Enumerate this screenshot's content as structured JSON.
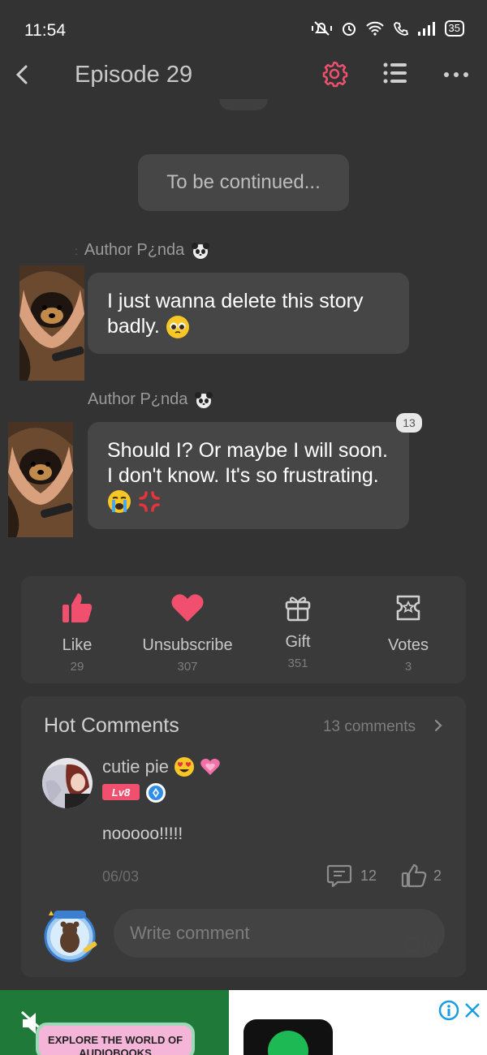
{
  "status": {
    "time": "11:54",
    "battery": "35",
    "icons": [
      "mute-vibrate-icon",
      "alarm-icon",
      "wifi-icon",
      "volte-call-icon",
      "signal-icon",
      "battery-icon"
    ]
  },
  "header": {
    "title": "Episode 29",
    "accent": "#f0506e"
  },
  "chapter": {
    "end_label": "To be continued..."
  },
  "messages": [
    {
      "author": "Author P¿nda",
      "text": "I just wanna delete this story badly."
    },
    {
      "author": "Author P¿nda",
      "text": "Should I? Or maybe I will soon. I don't know. It's so frustrating.",
      "badge": "13"
    }
  ],
  "actions": [
    {
      "label": "Like",
      "count": "29"
    },
    {
      "label": "Unsubscribe",
      "count": "307"
    },
    {
      "label": "Gift",
      "count": "351"
    },
    {
      "label": "Votes",
      "count": "3"
    }
  ],
  "comments": {
    "title": "Hot Comments",
    "count_label": "13 comments",
    "items": [
      {
        "user": "cutie pie",
        "level": "Lv8",
        "text": "nooooo!!!!!",
        "date": "06/03",
        "replies": "12",
        "likes": "2"
      }
    ],
    "input_placeholder": "Write comment"
  },
  "ad": {
    "headline": "EXPLORE THE WORLD OF AUDIOBOOKS"
  }
}
